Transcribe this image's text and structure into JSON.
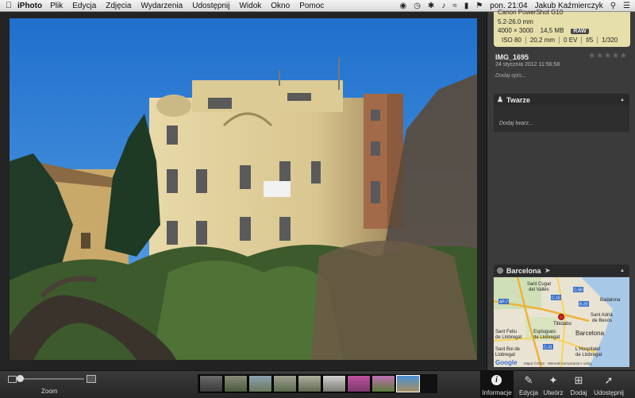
{
  "menubar": {
    "app_name": "iPhoto",
    "items": [
      "Plik",
      "Edycja",
      "Zdjęcia",
      "Wydarzenia",
      "Udostępnij",
      "Widok",
      "Okno",
      "Pomoc"
    ],
    "clock": "pon. 21:04",
    "user": "Jakub Kaźmierczyk"
  },
  "info": {
    "camera_model": "Canon PowerShot G10",
    "lens": "5.2-26.0 mm",
    "dimensions": "4000 × 3000",
    "size": "14,5 MB",
    "format": "RAW",
    "iso": "ISO 80",
    "focal": "20,2 mm",
    "ev": "0 EV",
    "aperture": "f/5",
    "shutter": "1/320",
    "filename": "IMG_1695",
    "datetime": "24 stycznia 2012 11:56:58",
    "rating": "★★★★★",
    "add_description": "Dodaj opis..."
  },
  "faces": {
    "title": "Twarze",
    "add_faces": "Dodaj twarz..."
  },
  "places": {
    "title": "Barcelona",
    "map_labels": {
      "sant_cugat": "Sant Cugat",
      "del_valles": "del Vallès",
      "badalona": "Badalona",
      "tibidabo": "Tibidabo",
      "sant_adria": "Sant Adrià",
      "de_besos": "de Besòs",
      "sant_feliu": "Sant Feliu",
      "de_llobregat1": "de Llobregat",
      "esplugues": "Esplugues",
      "de_llobregat2": "de Llobregat",
      "barcelona": "Barcelona",
      "sant_boi": "Sant Boi de",
      "llobregat": "Llobregat",
      "hospitalet": "L'Hospitalet",
      "de_llobregat3": "de Llobregat",
      "google": "Google",
      "attribution": "Mapa ©2012 · Warunki korzystania z usług"
    },
    "roads": [
      "AP-7",
      "C-16",
      "B-20",
      "C-58",
      "C-31"
    ]
  },
  "toolbar": {
    "zoom_label": "Zoom",
    "zoom_level": 0.0,
    "buttons": [
      {
        "label": "Informacje",
        "icon": "info-icon"
      },
      {
        "label": "Edycja",
        "icon": "pencil-icon"
      },
      {
        "label": "Utwórz",
        "icon": "create-icon"
      },
      {
        "label": "Dodaj",
        "icon": "add-icon"
      },
      {
        "label": "Udostępnij",
        "icon": "share-icon"
      }
    ]
  },
  "colors": {
    "panel_bg": "#3b3b3b",
    "camera_box": "#e6dfaa",
    "sky": "#2f7fd6",
    "accent_selected": "#ffffff"
  }
}
